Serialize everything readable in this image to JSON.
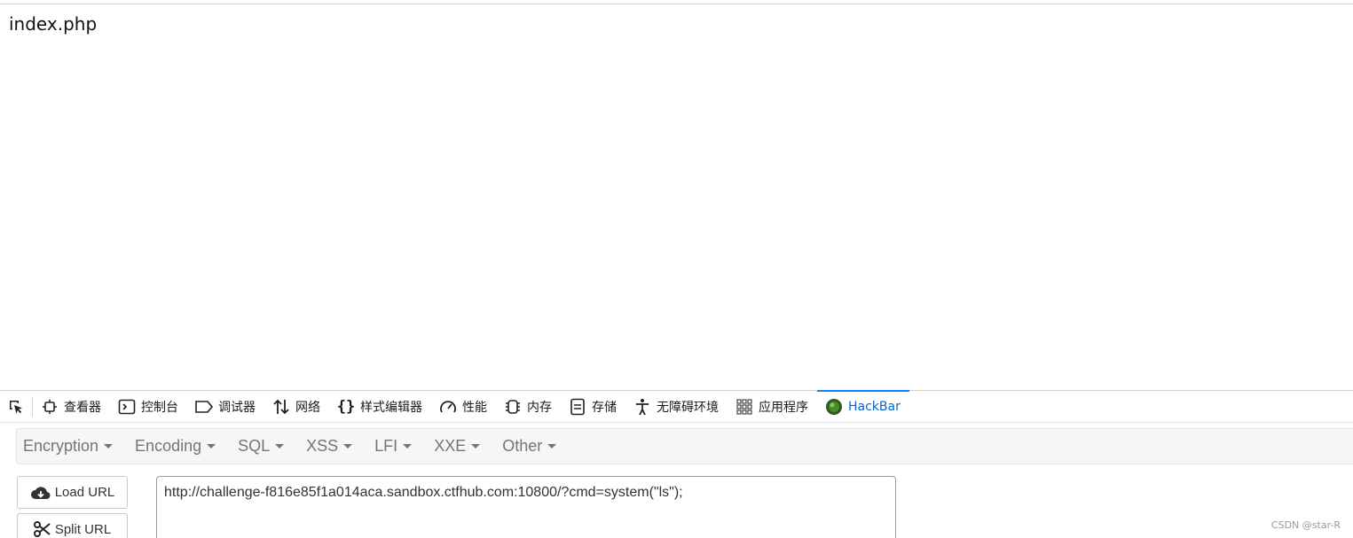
{
  "page": {
    "content_text": "index.php"
  },
  "devtools": {
    "tabs": [
      {
        "label": "查看器",
        "icon": "inspector-icon"
      },
      {
        "label": "控制台",
        "icon": "console-icon"
      },
      {
        "label": "调试器",
        "icon": "debugger-icon"
      },
      {
        "label": "网络",
        "icon": "network-icon"
      },
      {
        "label": "样式编辑器",
        "icon": "style-editor-icon"
      },
      {
        "label": "性能",
        "icon": "performance-icon"
      },
      {
        "label": "内存",
        "icon": "memory-icon"
      },
      {
        "label": "存储",
        "icon": "storage-icon"
      },
      {
        "label": "无障碍环境",
        "icon": "accessibility-icon"
      },
      {
        "label": "应用程序",
        "icon": "application-icon"
      },
      {
        "label": "HackBar",
        "icon": "hackbar-icon",
        "active": true
      }
    ]
  },
  "hackbar": {
    "menu": [
      {
        "label": "Encryption"
      },
      {
        "label": "Encoding"
      },
      {
        "label": "SQL"
      },
      {
        "label": "XSS"
      },
      {
        "label": "LFI"
      },
      {
        "label": "XXE"
      },
      {
        "label": "Other"
      }
    ],
    "load_url_label": "Load URL",
    "split_url_label": "Split URL",
    "url_value": "http://challenge-f816e85f1a014aca.sandbox.ctfhub.com:10800/?cmd=system(\"ls\");"
  },
  "watermark": "CSDN @star-R",
  "colors": {
    "active_tab": "#0a64c8",
    "active_tab_indicator": "#0a84ff",
    "menu_text": "#757575"
  }
}
